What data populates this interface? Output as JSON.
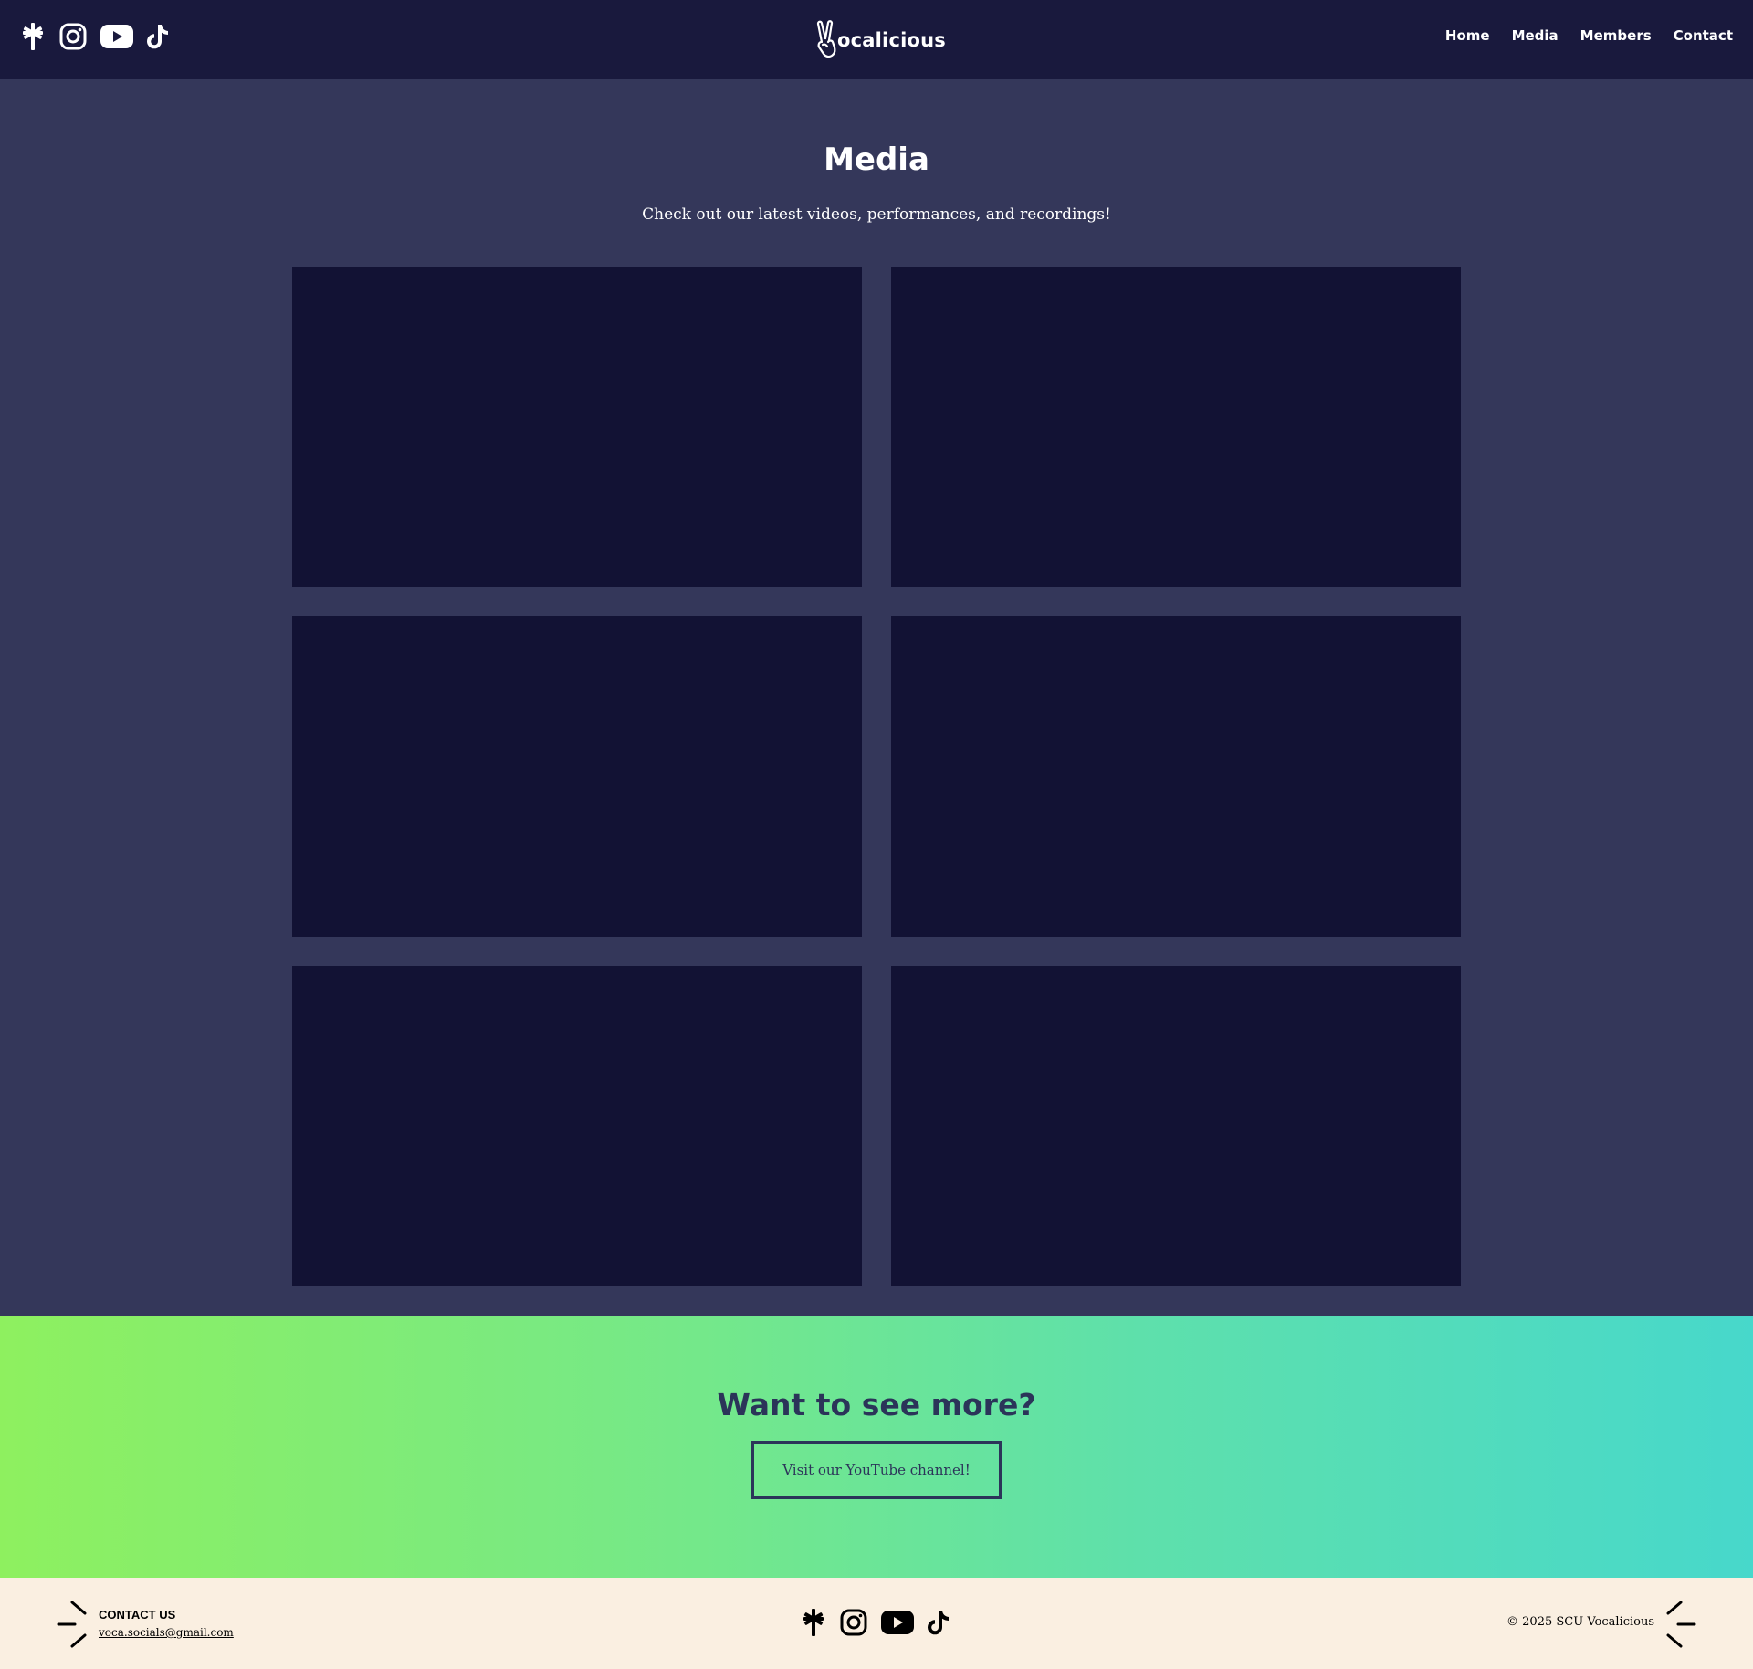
{
  "header": {
    "social": [
      "linktree-icon",
      "instagram-icon",
      "youtube-icon",
      "tiktok-icon"
    ],
    "logo_text": "ocalicious",
    "nav": [
      {
        "label": "Home"
      },
      {
        "label": "Media"
      },
      {
        "label": "Members"
      },
      {
        "label": "Contact"
      }
    ]
  },
  "main": {
    "title": "Media",
    "subtitle": "Check out our latest videos, performances, and recordings!",
    "tile_count": 6
  },
  "cta": {
    "title": "Want to see more?",
    "button_label": "Visit our YouTube channel!"
  },
  "footer": {
    "contact_label": "CONTACT US",
    "contact_email": "voca.socials@gmail.com",
    "social": [
      "linktree-icon",
      "instagram-icon",
      "youtube-icon",
      "tiktok-icon"
    ],
    "copyright": "© 2025 SCU Vocalicious"
  },
  "colors": {
    "header_bg": "#19193d",
    "page_bg": "#34375a",
    "tile_bg": "#121234",
    "cta_gradient_start": "#8ef05f",
    "cta_gradient_end": "#47d8cb",
    "cta_text": "#2b3459",
    "footer_bg": "#faefe1"
  }
}
